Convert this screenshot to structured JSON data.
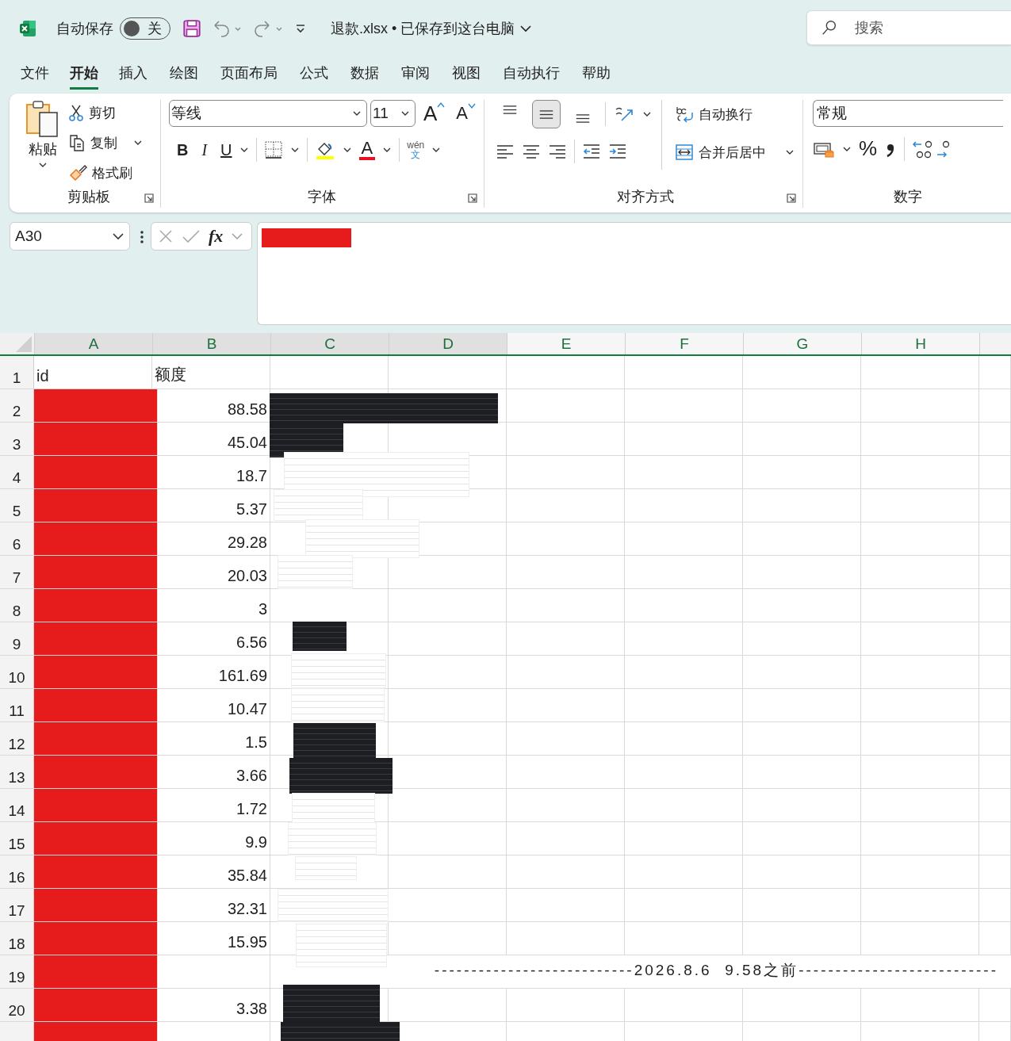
{
  "title_bar": {
    "autosave_label": "自动保存",
    "autosave": {
      "on": false,
      "label": "关"
    },
    "file_title": "退款.xlsx • 已保存到这台电脑",
    "search": {
      "placeholder": "搜索"
    }
  },
  "tabs": [
    {
      "label": "文件",
      "selected": false
    },
    {
      "label": "开始",
      "selected": true
    },
    {
      "label": "插入",
      "selected": false
    },
    {
      "label": "绘图",
      "selected": false
    },
    {
      "label": "页面布局",
      "selected": false
    },
    {
      "label": "公式",
      "selected": false
    },
    {
      "label": "数据",
      "selected": false
    },
    {
      "label": "审阅",
      "selected": false
    },
    {
      "label": "视图",
      "selected": false
    },
    {
      "label": "自动执行",
      "selected": false
    },
    {
      "label": "帮助",
      "selected": false
    }
  ],
  "ribbon": {
    "clipboard": {
      "paste": "粘贴",
      "cut": "剪切",
      "copy": "复制",
      "format_painter": "格式刷",
      "label": "剪贴板"
    },
    "font": {
      "font_name": "等线",
      "font_size": "11",
      "bold": "B",
      "italic": "I",
      "underline": "U",
      "font_color": "A",
      "grow": "A",
      "shrink": "A",
      "phonetic_top": "wén",
      "phonetic_bottom": "文",
      "label": "字体"
    },
    "alignment": {
      "vertical": [
        {
          "kind": "top",
          "selected": false
        },
        {
          "kind": "middle",
          "selected": true
        },
        {
          "kind": "bottom",
          "selected": false
        }
      ],
      "wrap": "自动换行",
      "merge": "合并后居中",
      "label": "对齐方式"
    },
    "number": {
      "format": "常规",
      "percent": "%",
      "label": "数字"
    }
  },
  "formula_bar": {
    "name_box": "A30",
    "fx": "fx",
    "content_redacted": true
  },
  "sheet": {
    "columns": [
      {
        "label": "A",
        "selected": true
      },
      {
        "label": "B",
        "selected": true
      },
      {
        "label": "C",
        "selected": true
      },
      {
        "label": "D",
        "selected": true
      },
      {
        "label": "E",
        "selected": false
      },
      {
        "label": "F",
        "selected": false
      },
      {
        "label": "G",
        "selected": false
      },
      {
        "label": "H",
        "selected": false
      }
    ],
    "header_row": {
      "number": "1",
      "a": "id",
      "b": "额度"
    },
    "rows": [
      {
        "number": "2",
        "a_redacted": true,
        "b": "88.58"
      },
      {
        "number": "3",
        "a_redacted": true,
        "b": "45.04"
      },
      {
        "number": "4",
        "a_redacted": true,
        "b": "18.7"
      },
      {
        "number": "5",
        "a_redacted": true,
        "b": "5.37"
      },
      {
        "number": "6",
        "a_redacted": true,
        "b": "29.28"
      },
      {
        "number": "7",
        "a_redacted": true,
        "b": "20.03"
      },
      {
        "number": "8",
        "a_redacted": true,
        "b": "3"
      },
      {
        "number": "9",
        "a_redacted": true,
        "b": "6.56"
      },
      {
        "number": "10",
        "a_redacted": true,
        "b": "161.69"
      },
      {
        "number": "11",
        "a_redacted": true,
        "b": "10.47"
      },
      {
        "number": "12",
        "a_redacted": true,
        "b": "1.5"
      },
      {
        "number": "13",
        "a_redacted": true,
        "b": "3.66"
      },
      {
        "number": "14",
        "a_redacted": true,
        "b": "1.72"
      },
      {
        "number": "15",
        "a_redacted": true,
        "b": "9.9"
      },
      {
        "number": "16",
        "a_redacted": true,
        "b": "35.84"
      },
      {
        "number": "17",
        "a_redacted": true,
        "b": "32.31"
      },
      {
        "number": "18",
        "a_redacted": true,
        "b": "15.95"
      },
      {
        "number": "19",
        "a_redacted": true,
        "note": "---------------------------2026.8.6  9.58之前---------------------------"
      },
      {
        "number": "20",
        "a_redacted": true,
        "b": "3.38"
      }
    ],
    "images": [
      {
        "kind": "dark"
      },
      {
        "kind": "dark"
      },
      {
        "kind": "light"
      },
      {
        "kind": "light"
      },
      {
        "kind": "light"
      },
      {
        "kind": "light"
      },
      {
        "kind": "dark"
      },
      {
        "kind": "light"
      },
      {
        "kind": "light"
      },
      {
        "kind": "dark"
      },
      {
        "kind": "dark"
      },
      {
        "kind": "light"
      },
      {
        "kind": "light"
      },
      {
        "kind": "light"
      },
      {
        "kind": "light"
      },
      {
        "kind": "light"
      },
      {
        "kind": "dark"
      },
      {
        "kind": "dark"
      }
    ]
  }
}
